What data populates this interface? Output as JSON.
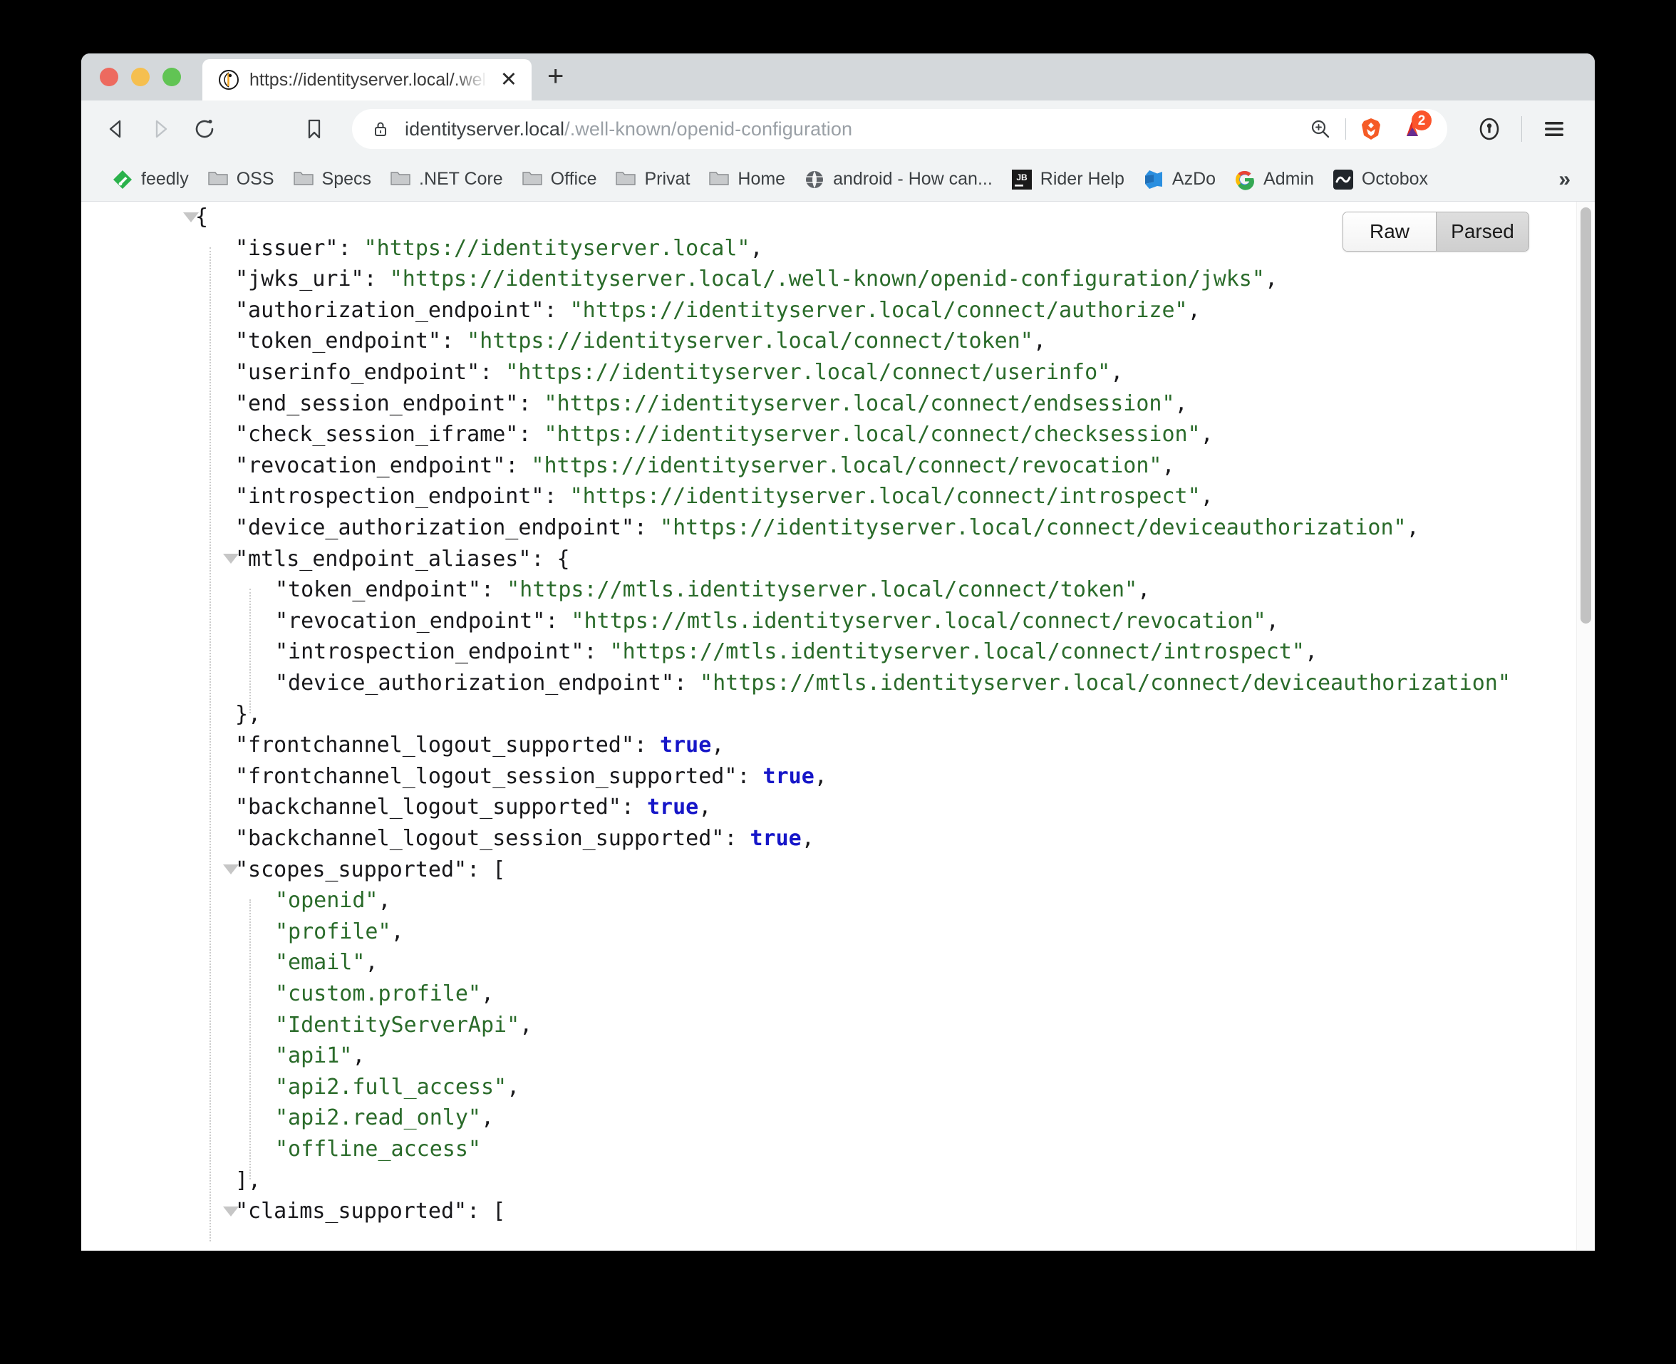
{
  "window": {
    "traffic_lights": [
      "close",
      "minimize",
      "maximize"
    ]
  },
  "tab": {
    "title": "https://identityserver.local/.well-kn",
    "favicon": "identityserver-favicon",
    "close_label": "✕",
    "new_tab_label": "+"
  },
  "toolbar": {
    "back_label": "back-arrow",
    "forward_label": "forward-arrow",
    "reload_label": "reload-arrow",
    "bookmark_label": "bookmark-outline",
    "url_host": "identityserver.local",
    "url_path": "/.well-known/openid-configuration",
    "url_full": "identityserver.local/.well-known/openid-configuration",
    "lock_label": "lock-icon",
    "zoom_label": "zoom-magnifier-icon",
    "brave_shields_label": "brave-lion-icon",
    "bat_rewards_label": "bat-triangle-icon",
    "bat_badge_count": "2",
    "password_manager_label": "1password-icon",
    "menu_label": "hamburger-menu-icon"
  },
  "bookmarks": {
    "items": [
      {
        "label": "feedly",
        "icon": "feedly-icon"
      },
      {
        "label": "OSS",
        "icon": "folder-icon"
      },
      {
        "label": "Specs",
        "icon": "folder-icon"
      },
      {
        "label": ".NET Core",
        "icon": "folder-icon"
      },
      {
        "label": "Office",
        "icon": "folder-icon"
      },
      {
        "label": "Privat",
        "icon": "folder-icon"
      },
      {
        "label": "Home",
        "icon": "folder-icon"
      },
      {
        "label": "android - How can...",
        "icon": "globe-icon"
      },
      {
        "label": "Rider Help",
        "icon": "jetbrains-icon"
      },
      {
        "label": "AzDo",
        "icon": "azure-devops-icon"
      },
      {
        "label": "Admin",
        "icon": "google-icon"
      },
      {
        "label": "Octobox",
        "icon": "octobox-icon"
      }
    ],
    "overflow_label": "»"
  },
  "json_viewer": {
    "view_modes": [
      {
        "label": "Raw",
        "active": false
      },
      {
        "label": "Parsed",
        "active": true
      }
    ],
    "lines": [
      {
        "indent": 0,
        "twisty": true,
        "text": "{",
        "type": "punct"
      },
      {
        "indent": 1,
        "key": "issuer",
        "value": "https://identityserver.local",
        "type": "string",
        "trailing": ","
      },
      {
        "indent": 1,
        "key": "jwks_uri",
        "value": "https://identityserver.local/.well-known/openid-configuration/jwks",
        "type": "string",
        "trailing": ","
      },
      {
        "indent": 1,
        "key": "authorization_endpoint",
        "value": "https://identityserver.local/connect/authorize",
        "type": "string",
        "trailing": ","
      },
      {
        "indent": 1,
        "key": "token_endpoint",
        "value": "https://identityserver.local/connect/token",
        "type": "string",
        "trailing": ","
      },
      {
        "indent": 1,
        "key": "userinfo_endpoint",
        "value": "https://identityserver.local/connect/userinfo",
        "type": "string",
        "trailing": ","
      },
      {
        "indent": 1,
        "key": "end_session_endpoint",
        "value": "https://identityserver.local/connect/endsession",
        "type": "string",
        "trailing": ","
      },
      {
        "indent": 1,
        "key": "check_session_iframe",
        "value": "https://identityserver.local/connect/checksession",
        "type": "string",
        "trailing": ","
      },
      {
        "indent": 1,
        "key": "revocation_endpoint",
        "value": "https://identityserver.local/connect/revocation",
        "type": "string",
        "trailing": ","
      },
      {
        "indent": 1,
        "key": "introspection_endpoint",
        "value": "https://identityserver.local/connect/introspect",
        "type": "string",
        "trailing": ","
      },
      {
        "indent": 1,
        "key": "device_authorization_endpoint",
        "value": "https://identityserver.local/connect/deviceauthorization",
        "type": "string",
        "trailing": ","
      },
      {
        "indent": 1,
        "twisty": true,
        "key": "mtls_endpoint_aliases",
        "value": "{",
        "type": "open"
      },
      {
        "indent": 2,
        "key": "token_endpoint",
        "value": "https://mtls.identityserver.local/connect/token",
        "type": "string",
        "trailing": ","
      },
      {
        "indent": 2,
        "key": "revocation_endpoint",
        "value": "https://mtls.identityserver.local/connect/revocation",
        "type": "string",
        "trailing": ","
      },
      {
        "indent": 2,
        "key": "introspection_endpoint",
        "value": "https://mtls.identityserver.local/connect/introspect",
        "type": "string",
        "trailing": ","
      },
      {
        "indent": 2,
        "key": "device_authorization_endpoint",
        "value": "https://mtls.identityserver.local/connect/deviceauthorization",
        "type": "string",
        "trailing": ""
      },
      {
        "indent": 1,
        "text": "},",
        "type": "punct"
      },
      {
        "indent": 1,
        "key": "frontchannel_logout_supported",
        "value": "true",
        "type": "bool",
        "trailing": ","
      },
      {
        "indent": 1,
        "key": "frontchannel_logout_session_supported",
        "value": "true",
        "type": "bool",
        "trailing": ","
      },
      {
        "indent": 1,
        "key": "backchannel_logout_supported",
        "value": "true",
        "type": "bool",
        "trailing": ","
      },
      {
        "indent": 1,
        "key": "backchannel_logout_session_supported",
        "value": "true",
        "type": "bool",
        "trailing": ","
      },
      {
        "indent": 1,
        "twisty": true,
        "key": "scopes_supported",
        "value": "[",
        "type": "open"
      },
      {
        "indent": 2,
        "value": "openid",
        "type": "arraystring",
        "trailing": ","
      },
      {
        "indent": 2,
        "value": "profile",
        "type": "arraystring",
        "trailing": ","
      },
      {
        "indent": 2,
        "value": "email",
        "type": "arraystring",
        "trailing": ","
      },
      {
        "indent": 2,
        "value": "custom.profile",
        "type": "arraystring",
        "trailing": ","
      },
      {
        "indent": 2,
        "value": "IdentityServerApi",
        "type": "arraystring",
        "trailing": ","
      },
      {
        "indent": 2,
        "value": "api1",
        "type": "arraystring",
        "trailing": ","
      },
      {
        "indent": 2,
        "value": "api2.full_access",
        "type": "arraystring",
        "trailing": ","
      },
      {
        "indent": 2,
        "value": "api2.read_only",
        "type": "arraystring",
        "trailing": ","
      },
      {
        "indent": 2,
        "value": "offline_access",
        "type": "arraystring",
        "trailing": ""
      },
      {
        "indent": 1,
        "text": "],",
        "type": "punct"
      },
      {
        "indent": 1,
        "twisty": true,
        "key": "claims_supported",
        "value": "[",
        "type": "open"
      }
    ]
  },
  "colors": {
    "json_key": "#18181b",
    "json_string": "#2a6b2a",
    "json_bool": "#1616c8",
    "brave_orange": "#fb542b",
    "chrome_toolbar": "#f1f3f4",
    "tabstrip": "#d4d8db"
  }
}
